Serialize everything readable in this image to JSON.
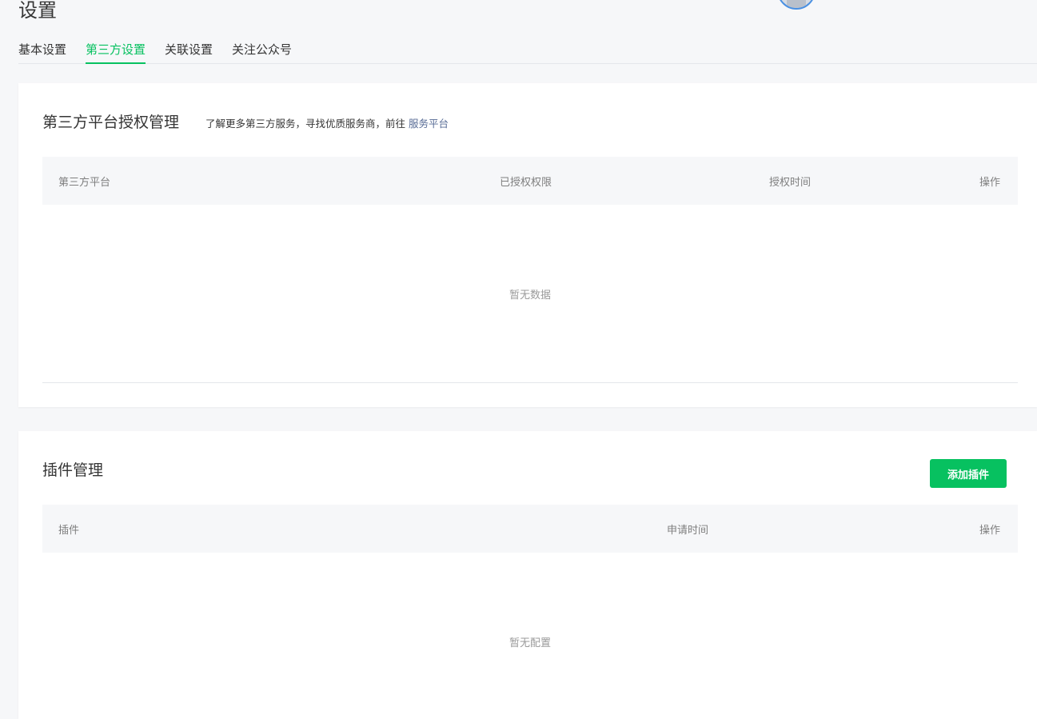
{
  "page": {
    "title": "设置"
  },
  "tabs": [
    {
      "label": "基本设置",
      "active": false
    },
    {
      "label": "第三方设置",
      "active": true
    },
    {
      "label": "关联设置",
      "active": false
    },
    {
      "label": "关注公众号",
      "active": false
    }
  ],
  "auth_panel": {
    "title": "第三方平台授权管理",
    "description": "了解更多第三方服务，寻找优质服务商，前往",
    "link_label": "服务平台",
    "columns": [
      "第三方平台",
      "已授权权限",
      "授权时间",
      "操作"
    ],
    "empty_text": "暂无数据"
  },
  "plugin_panel": {
    "title": "插件管理",
    "add_button_label": "添加插件",
    "columns": [
      "插件",
      "申请时间",
      "操作"
    ],
    "empty_text": "暂无配置"
  },
  "colors": {
    "accent": "#07c160",
    "link": "#576b95",
    "background": "#f6f7f9"
  }
}
